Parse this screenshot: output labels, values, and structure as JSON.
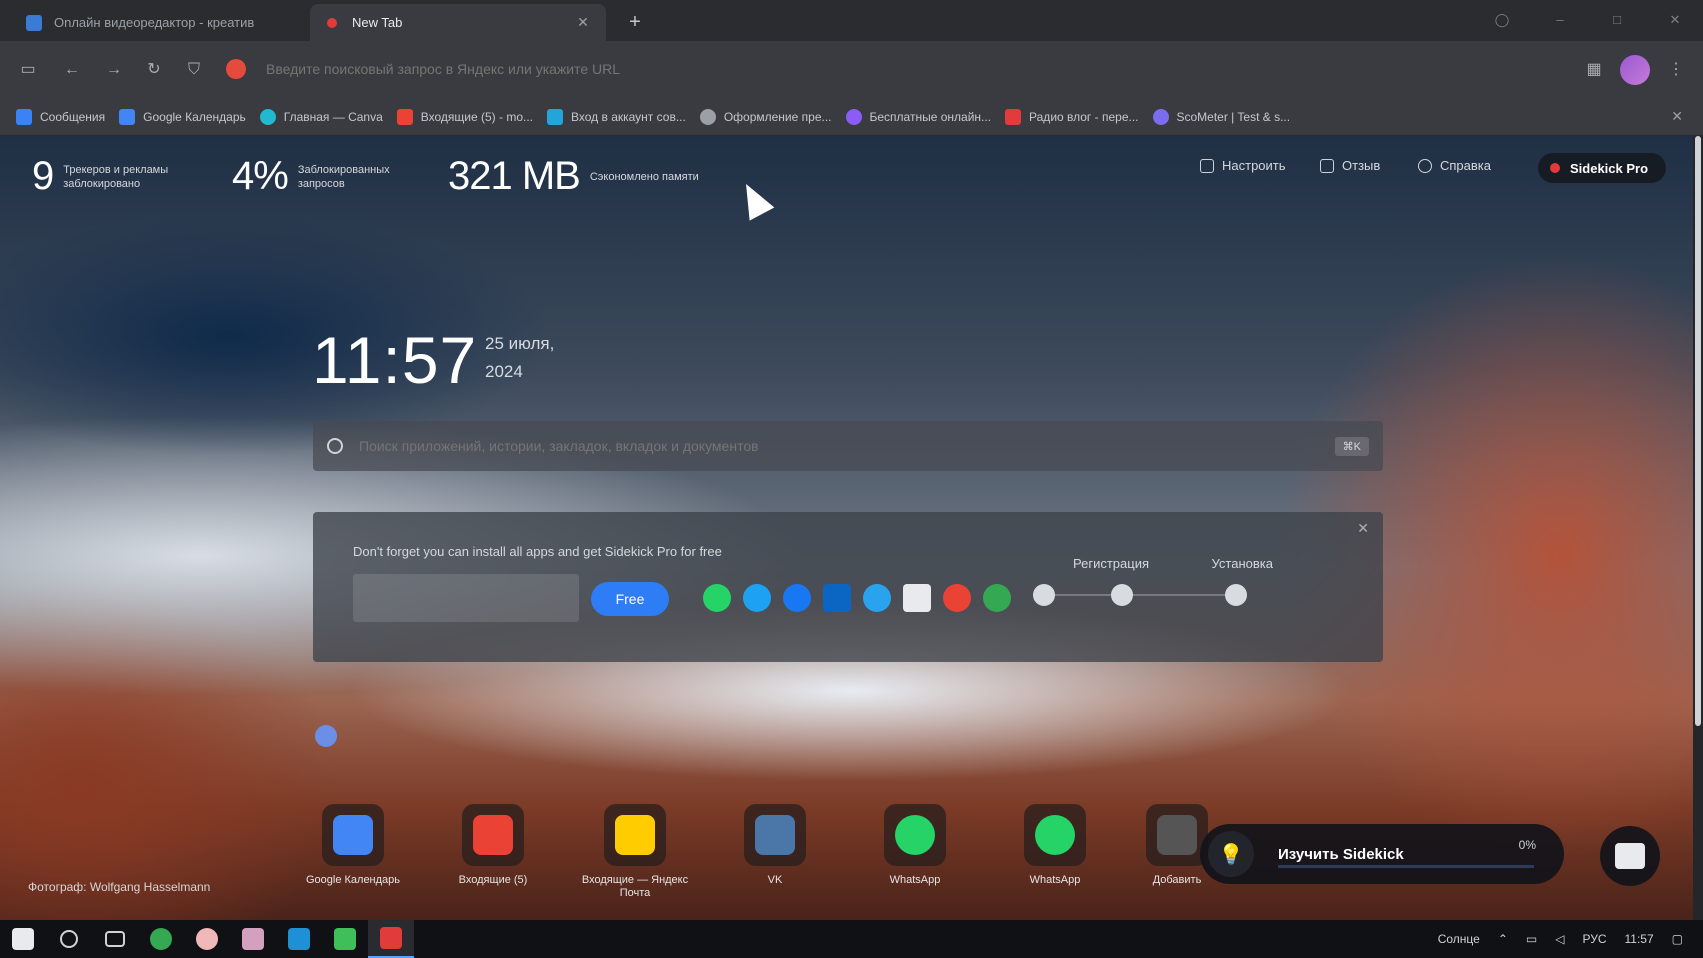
{
  "tabs": [
    {
      "title": "Onлайн видеоредактор - креатив",
      "active": false,
      "color": "#3a7bd5"
    },
    {
      "title": "New Tab",
      "active": true,
      "color": "#e23b3b"
    }
  ],
  "toolbar": {
    "address_placeholder": "Введите поисковый запрос в Яндекс или укажите URL"
  },
  "bookmarks": [
    {
      "label": "Сообщения",
      "color": "#3b82f6"
    },
    {
      "label": "Google Календарь",
      "color": "#4285f4"
    },
    {
      "label": "Главная — Canva",
      "color": "#22b8cf"
    },
    {
      "label": "Входящие (5) - mo...",
      "color": "#ea4335"
    },
    {
      "label": "Вход в аккаунт сов...",
      "color": "#22a6d8"
    },
    {
      "label": "Оформление пре...",
      "color": "#9aa0a6"
    },
    {
      "label": "Бесплатные онлайн...",
      "color": "#8b5cf6"
    },
    {
      "label": "Радио влог - пере...",
      "color": "#e23b3b"
    },
    {
      "label": "ScoMeter | Test & s...",
      "color": "#7c6cf0"
    }
  ],
  "stats": [
    {
      "value": "9",
      "label": "Трекеров и рекламы заблокировано"
    },
    {
      "value": "4%",
      "label": "Заблокированных запросов"
    },
    {
      "value": "321 MB",
      "label": "Сэкономлено памяти"
    }
  ],
  "top_actions": {
    "customize": "Настроить",
    "feedback": "Отзыв",
    "support": "Справка",
    "pro": "Sidekick Pro"
  },
  "clock": {
    "time": "11:57",
    "date_line1": "25 июля,",
    "date_line2": "2024"
  },
  "search": {
    "placeholder": "Поиск приложений, истории, закладок, вкладок и документов",
    "shortcut": "⌘K"
  },
  "widget": {
    "text": "Don't forget you can install all apps and get Sidekick Pro for free",
    "button": "Free",
    "step1": "Регистрация",
    "step2": "Установка",
    "apps": [
      "#25d366",
      "#1da1f2",
      "#1877f2",
      "#0a66c2",
      "#2aa3ef",
      "#e8eaed",
      "#ea4335",
      "#34a853"
    ]
  },
  "tiles": [
    {
      "label": "Google Календарь",
      "color": "#4285f4"
    },
    {
      "label": "Входящие (5)",
      "color": "#ea4335"
    },
    {
      "label": "Входящие — Яндекс Почта",
      "color": "#ffcc00"
    },
    {
      "label": "VK",
      "color": "#4a76a8"
    },
    {
      "label": "WhatsApp",
      "color": "#25d366"
    },
    {
      "label": "WhatsApp",
      "color": "#25d366"
    },
    {
      "label": "Добавить",
      "color": "#555555"
    }
  ],
  "credit": "Фотограф: Wolfgang Hasselmann",
  "sidekick": {
    "title": "Изучить Sidekick",
    "percent": "0%"
  },
  "tray": {
    "weather": "Солнце",
    "lang": "РУС",
    "time": "11:57"
  }
}
